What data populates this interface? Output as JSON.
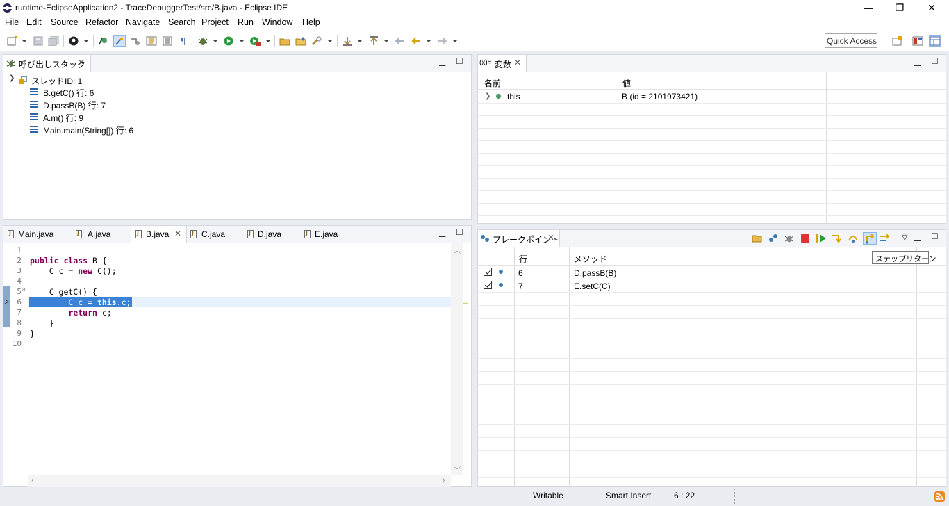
{
  "window": {
    "title": "runtime-EclipseApplication2 - TraceDebuggerTest/src/B.java - Eclipse IDE",
    "minimize": "—",
    "maximize": "❐",
    "close": "✕"
  },
  "menu": [
    "File",
    "Edit",
    "Source",
    "Refactor",
    "Navigate",
    "Search",
    "Project",
    "Run",
    "Window",
    "Help"
  ],
  "toolbar": {
    "quick_access": "Quick Access"
  },
  "call_stack": {
    "tab": "呼び出しスタック",
    "thread": "スレッドID: 1",
    "frames": [
      "B.getC() 行: 6",
      "D.passB(B) 行: 7",
      "A.m() 行: 9",
      "Main.main(String[]) 行: 6"
    ]
  },
  "variables": {
    "tab_prefix": "(x)=",
    "tab": "変数",
    "col_name": "名前",
    "col_value": "値",
    "rows": [
      {
        "name": "this",
        "value": "B (id = 2101973421)"
      }
    ]
  },
  "editor": {
    "tabs": [
      "Main.java",
      "A.java",
      "B.java",
      "C.java",
      "D.java",
      "E.java"
    ],
    "active_tab": "B.java",
    "line_numbers": [
      "1",
      "2",
      "3",
      "4",
      "5",
      "6",
      "7",
      "8",
      "9",
      "10"
    ],
    "fold_marker": "⊖"
  },
  "breakpoints": {
    "tab": "ブレークポイント",
    "col_line": "行",
    "col_method": "メソッド",
    "rows": [
      {
        "line": "6",
        "method": "D.passB(B)"
      },
      {
        "line": "7",
        "method": "E.setC(C)"
      }
    ],
    "tooltip": "ステップリターン"
  },
  "status": {
    "writable": "Writable",
    "insert_mode": "Smart Insert",
    "position": "6 : 22"
  },
  "colors": {
    "selection": "#3a82d6",
    "current_line": "#e8f2fe",
    "keyword": "#7f0055"
  }
}
